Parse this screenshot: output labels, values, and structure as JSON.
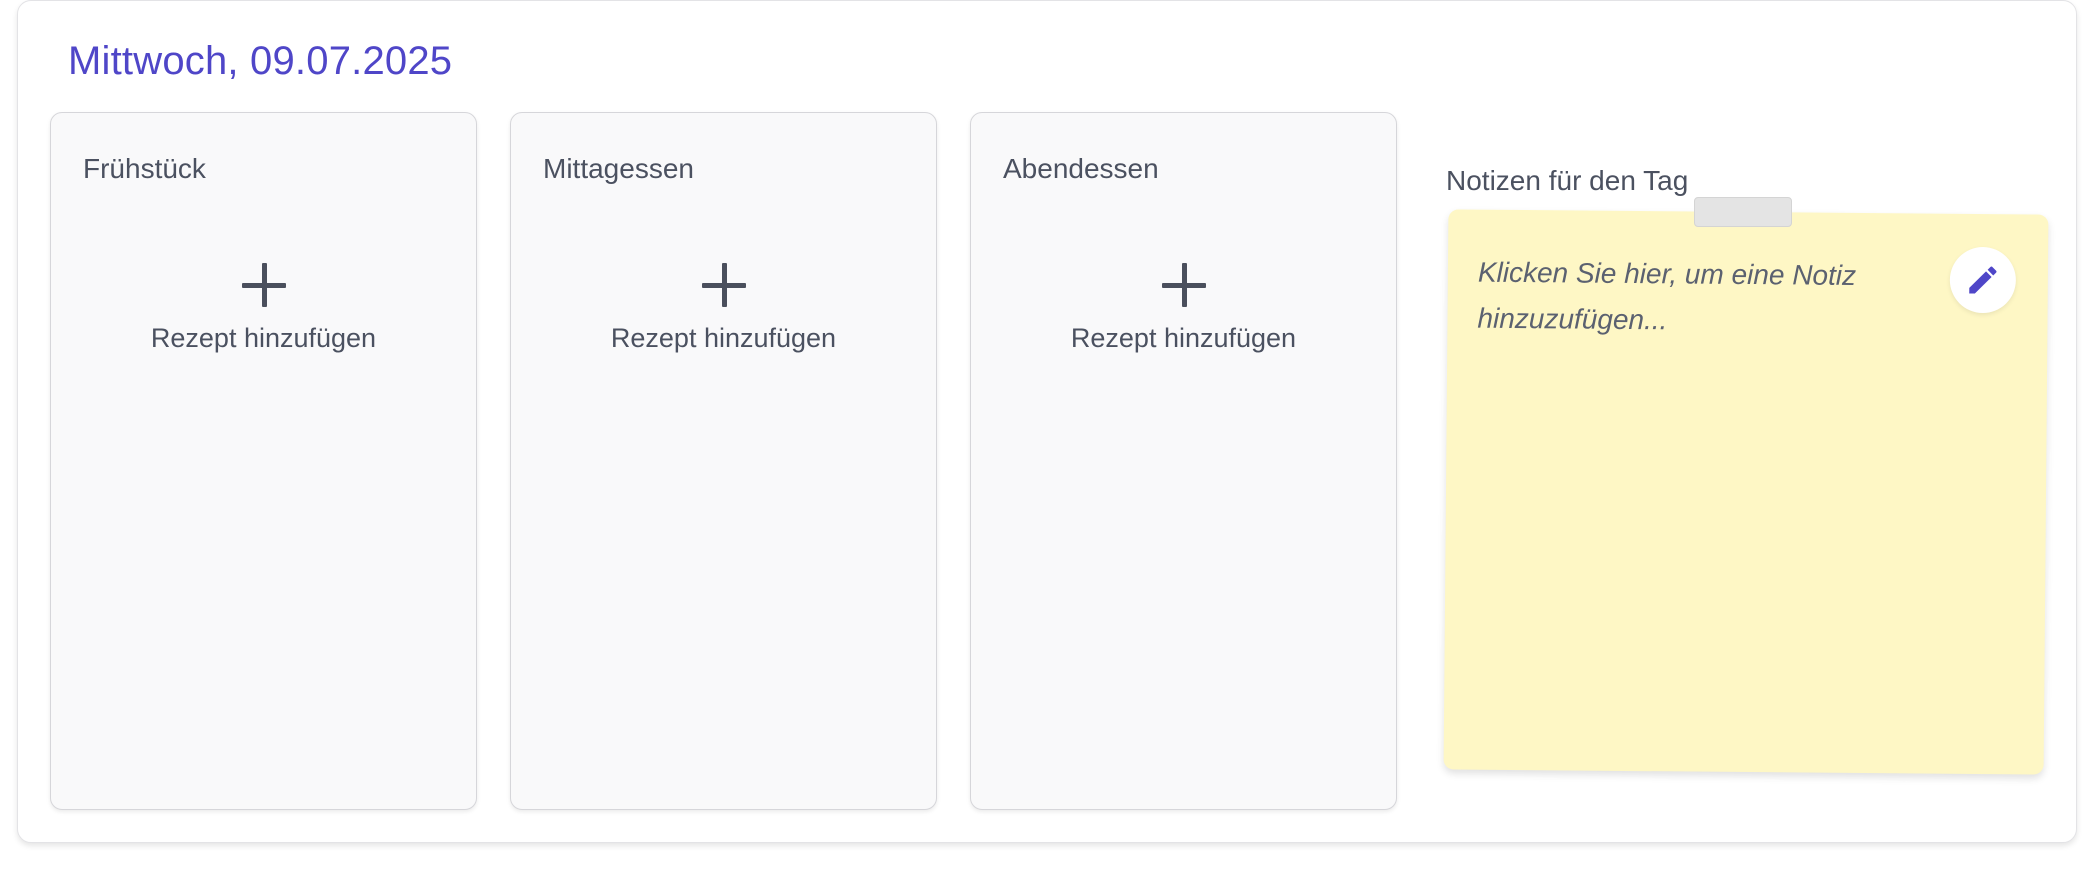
{
  "day": {
    "title": "Mittwoch, 09.07.2025"
  },
  "meals": [
    {
      "title": "Frühstück",
      "add_label": "Rezept hinzufügen"
    },
    {
      "title": "Mittagessen",
      "add_label": "Rezept hinzufügen"
    },
    {
      "title": "Abendessen",
      "add_label": "Rezept hinzufügen"
    }
  ],
  "notes": {
    "label": "Notizen für den Tag",
    "placeholder": "Klicken Sie hier, um eine Notiz hinzuzufügen...",
    "edit_icon": "pencil-icon"
  },
  "colors": {
    "accent": "#4f46c8",
    "sticky_note": "#fef7c5",
    "meal_card": "#f9f9fa",
    "text": "#4b5160"
  }
}
